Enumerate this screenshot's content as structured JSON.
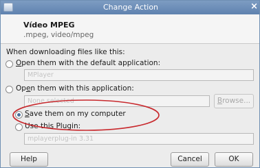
{
  "window": {
    "title": "Change Action"
  },
  "header": {
    "title": "Vídeo MPEG",
    "subtitle": ".mpeg, video/mpeg"
  },
  "form": {
    "prompt": "When downloading files like this:",
    "option_default": {
      "pre": "",
      "mnemonic": "O",
      "post": "pen them with the default application:"
    },
    "default_app_value": "MPlayer",
    "option_app": {
      "pre": "Op",
      "mnemonic": "e",
      "post": "n them with this application:"
    },
    "app_value": "None selected",
    "browse": {
      "pre": "",
      "mnemonic": "B",
      "post": "rowse..."
    },
    "option_save": {
      "pre": "",
      "mnemonic": "S",
      "post": "ave them on my computer"
    },
    "option_plugin": {
      "pre": "Use this ",
      "mnemonic": "P",
      "post": "lugin:"
    },
    "plugin_value": "mplayerplug-in 3.31",
    "selected_option": "save"
  },
  "buttons": {
    "help": "Help",
    "cancel": "Cancel",
    "ok": "OK"
  },
  "colors": {
    "annotation": "#c8282c",
    "titlebar": "#6688b4"
  }
}
